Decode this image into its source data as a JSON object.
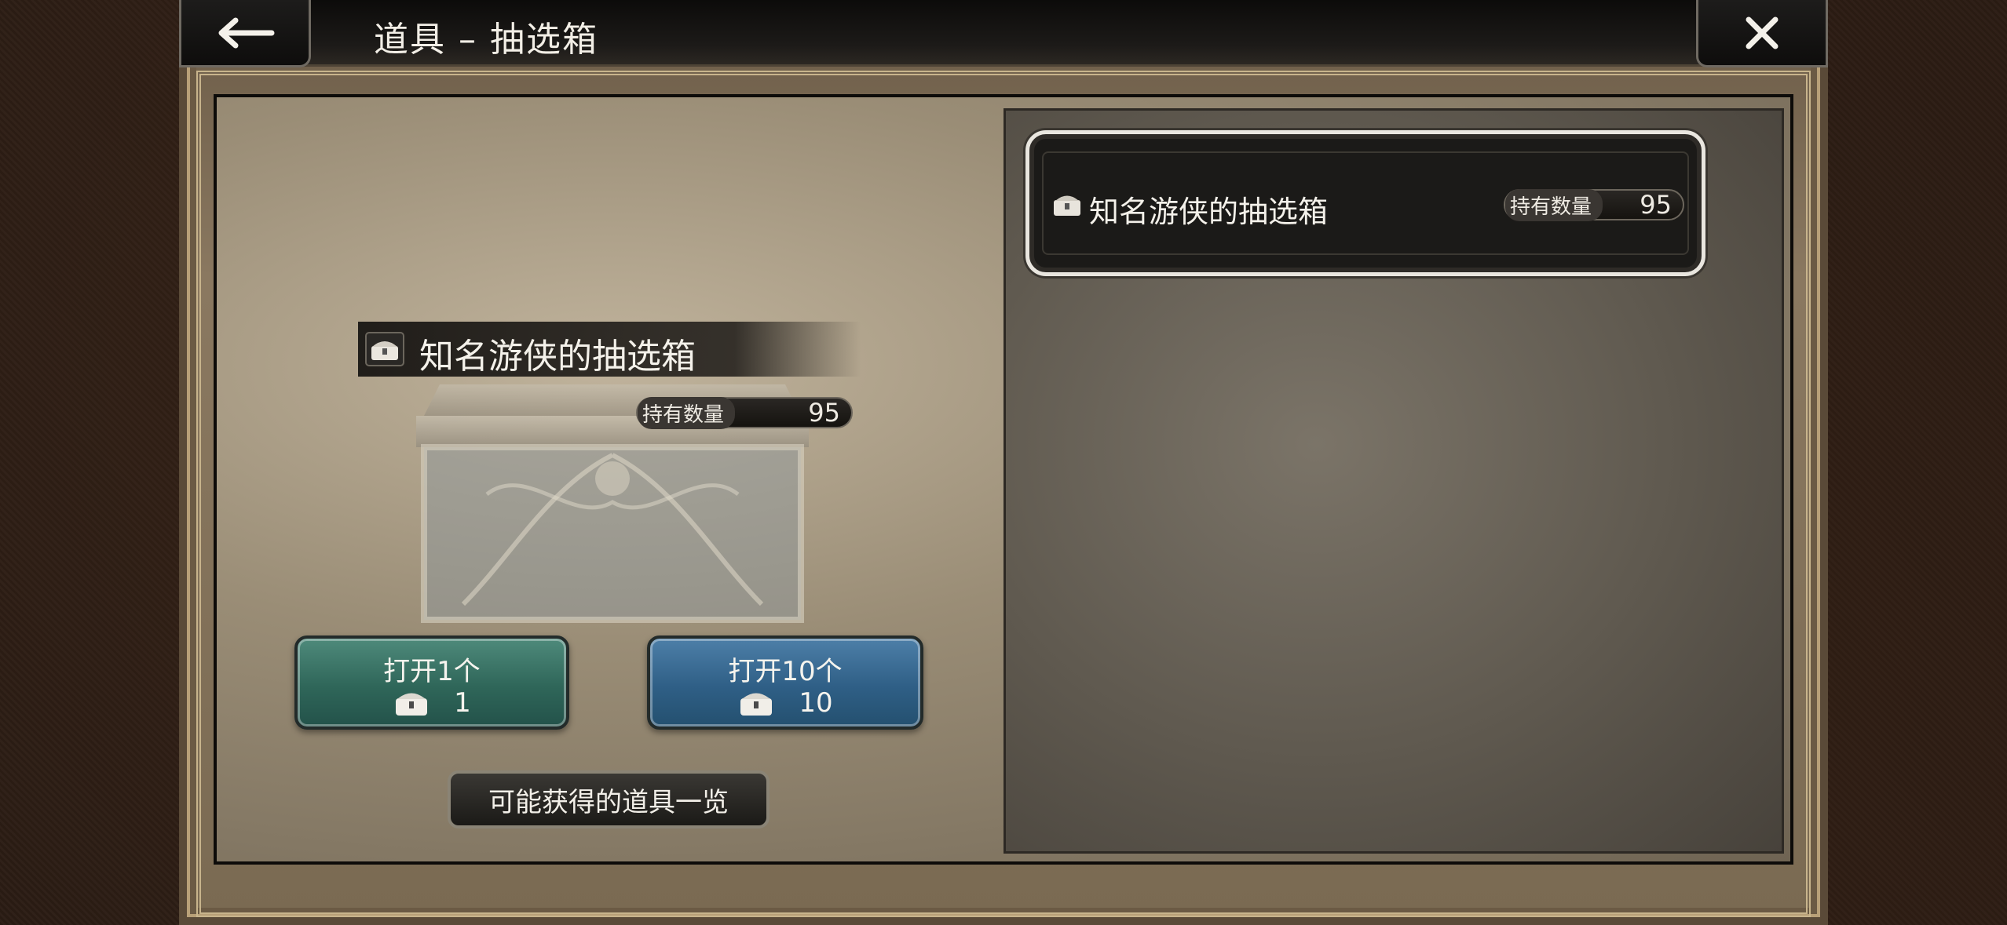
{
  "header": {
    "title": "道具 – 抽选箱",
    "back_icon": "back-arrow-icon",
    "close_icon": "close-icon"
  },
  "list": {
    "items": [
      {
        "name": "知名游侠的抽选箱",
        "count_label": "持有数量",
        "count": "95",
        "icon": "chest-icon"
      }
    ]
  },
  "detail": {
    "name": "知名游侠的抽选箱",
    "count_label": "持有数量",
    "count": "95",
    "icon": "chest-icon"
  },
  "actions": {
    "open1": {
      "label": "打开1个",
      "cost": "1",
      "color": "#2f6659"
    },
    "open10": {
      "label": "打开10个",
      "cost": "10",
      "color": "#2f5f86"
    },
    "list_button": "可能获得的道具一览"
  }
}
